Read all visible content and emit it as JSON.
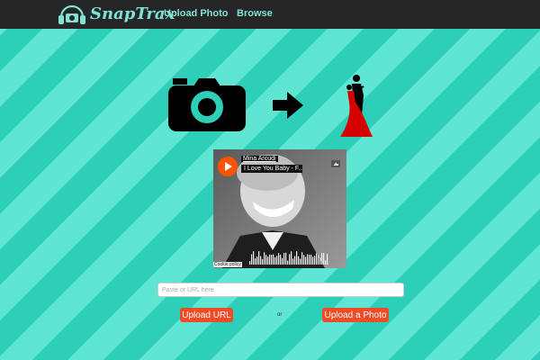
{
  "navbar": {
    "logo_text": "SnapTrax",
    "links": [
      {
        "label": "Upload Photo"
      },
      {
        "label": "Browse"
      }
    ]
  },
  "hero": {
    "icons": [
      "camera-icon",
      "arrow-right-icon",
      "dancers-icon"
    ]
  },
  "player": {
    "artist": "Mina Arcudi",
    "track": "I Love You Baby - F...",
    "cookie_policy": "Cookie policy"
  },
  "upload": {
    "url_placeholder": "Paste or URL here",
    "upload_url_label": "Upload URL",
    "or_label": "or",
    "upload_photo_label": "Upload a Photo"
  },
  "colors": {
    "nav_bg": "#262626",
    "accent": "#7ee3d6",
    "button": "#ee4b26",
    "stripe_light": "#5ee6d2",
    "stripe_dark": "#2dcfb8",
    "soundcloud": "#ff5500"
  }
}
